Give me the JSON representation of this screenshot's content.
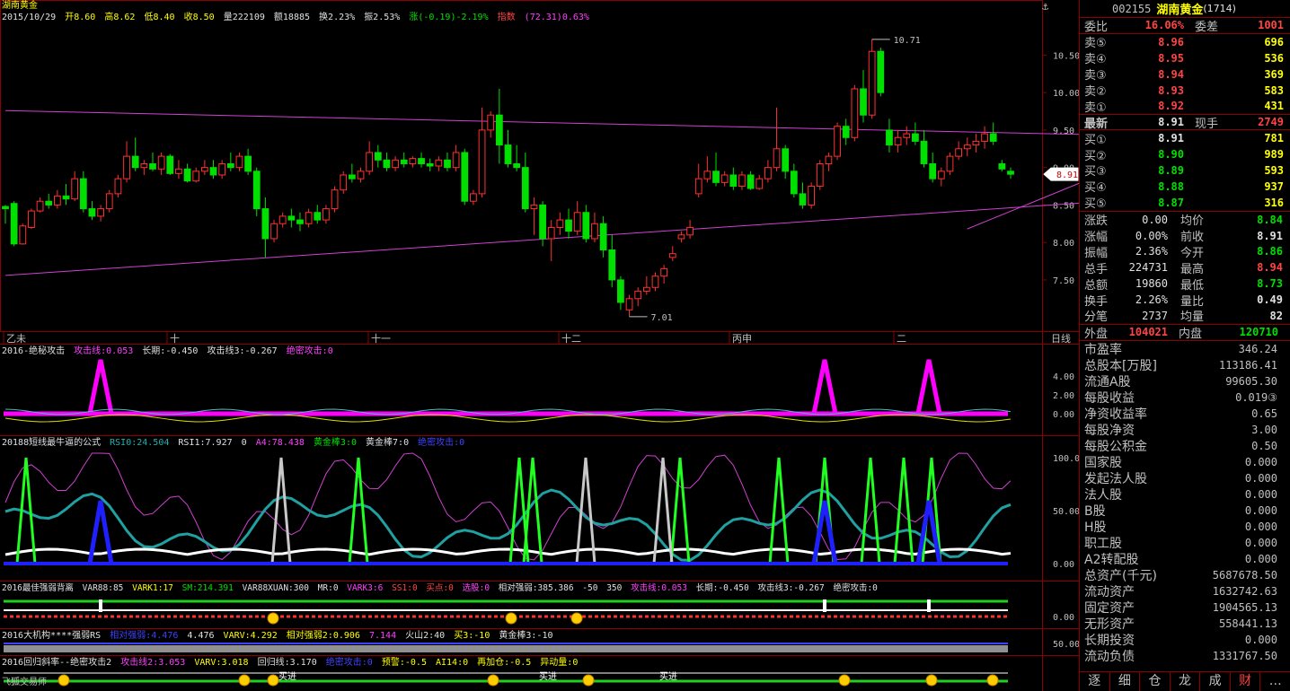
{
  "stock": {
    "name_cn": "湖南黄金",
    "date": "2015/10/29",
    "open": "开8.60",
    "high": "高8.62",
    "low": "低8.40",
    "close": "收8.50",
    "volume": "量222109",
    "amount": "额18885",
    "turnover": "换2.23%",
    "amplitude": "振2.53%",
    "change": "涨(-0.19)-2.19%",
    "index_label": "指数",
    "index_value": "(72.31)0.63%"
  },
  "price_axis": {
    "ticks": [
      "10.50",
      "10.00",
      "9.50",
      "9.00",
      "8.50",
      "8.00",
      "7.50"
    ],
    "current_price": "8.91",
    "high_mark": "10.71",
    "low_mark": "7.01"
  },
  "time_axis": {
    "labels": [
      "乙未",
      "十",
      "十一",
      "十二",
      "丙申",
      "二"
    ],
    "period": "日线"
  },
  "indicators": {
    "ind1": {
      "title": "2016-绝秘攻击",
      "params": [
        "攻击线:0.053",
        "长期:-0.450",
        "攻击线3:-0.267",
        "绝密攻击:0"
      ],
      "ticks": [
        "4.00",
        "2.00",
        "0.00"
      ]
    },
    "ind2": {
      "title": "20188短线最牛逼的公式",
      "params": [
        "RSI0:24.504",
        "RSI1:7.927",
        "0",
        "A4:78.438",
        "黄金棒3:0",
        "黄金棒7:0",
        "绝密攻击:0"
      ],
      "ticks": [
        "100.00",
        "50.00",
        "0.00"
      ]
    },
    "ind3": {
      "title": "2016最佳强弱背离",
      "params": [
        "VAR88:85",
        "VARK1:17",
        "SM:214.391",
        "VAR88XUAN:300",
        "MR:0",
        "VARK3:6",
        "SS1:0",
        "买点:0",
        "选股:0",
        "相对强弱:385.386",
        "-50",
        "350",
        "攻击线:0.053",
        "长期:-0.450",
        "攻击线3:-0.267",
        "绝密攻击:0"
      ],
      "ticks": [
        "0.00"
      ]
    },
    "ind4": {
      "title": "2016大机构****强弱RS",
      "params": [
        "相对强弱:4.476",
        "4.476",
        "VARV:4.292",
        "相对强弱2:0.906",
        "7.144",
        "火山2:40",
        "买3:-10",
        "黄金棒3:-10"
      ],
      "ticks": [
        "50.00"
      ]
    },
    "ind5": {
      "title": "2016回归斜率--绝密攻击2",
      "params": [
        "攻击线2:3.053",
        "VARV:3.018",
        "回归线:3.170",
        "绝密攻击:0",
        "预警:-0.5",
        "AI14:0",
        "再加仓:-0.5",
        "异动量:0"
      ],
      "footer": "飞狐交易师",
      "marker_text": "买进"
    }
  },
  "quote": {
    "code": "002155",
    "name": "湖南黄金",
    "code_suffix": "(1714)",
    "wei_bi_label": "委比",
    "wei_bi": "16.06%",
    "wei_cha_label": "委差",
    "wei_cha": "1001",
    "sell": [
      {
        "label": "卖⑤",
        "price": "8.96",
        "vol": "696"
      },
      {
        "label": "卖④",
        "price": "8.95",
        "vol": "536"
      },
      {
        "label": "卖③",
        "price": "8.94",
        "vol": "369"
      },
      {
        "label": "卖②",
        "price": "8.93",
        "vol": "583"
      },
      {
        "label": "卖①",
        "price": "8.92",
        "vol": "431"
      }
    ],
    "latest_label": "最新",
    "latest": "8.91",
    "xianshou_label": "现手",
    "xianshou": "2749",
    "buy": [
      {
        "label": "买①",
        "price": "8.91",
        "vol": "781"
      },
      {
        "label": "买②",
        "price": "8.90",
        "vol": "989"
      },
      {
        "label": "买③",
        "price": "8.89",
        "vol": "593"
      },
      {
        "label": "买④",
        "price": "8.88",
        "vol": "937"
      },
      {
        "label": "买⑤",
        "price": "8.87",
        "vol": "316"
      }
    ],
    "stats": [
      {
        "l1": "涨跌",
        "v1": "0.00",
        "l2": "均价",
        "v2": "8.84",
        "c2": "green"
      },
      {
        "l1": "涨幅",
        "v1": "0.00%",
        "l2": "前收",
        "v2": "8.91",
        "c2": "white"
      },
      {
        "l1": "振幅",
        "v1": "2.36%",
        "l2": "今开",
        "v2": "8.86",
        "c2": "green"
      },
      {
        "l1": "总手",
        "v1": "224731",
        "l2": "最高",
        "v2": "8.94",
        "c2": "red"
      },
      {
        "l1": "总额",
        "v1": "19860",
        "l2": "最低",
        "v2": "8.73",
        "c2": "green"
      },
      {
        "l1": "换手",
        "v1": "2.26%",
        "l2": "量比",
        "v2": "0.49",
        "c2": "white"
      },
      {
        "l1": "分笔",
        "v1": "2737",
        "l2": "均量",
        "v2": "82",
        "c2": "white"
      }
    ],
    "waipan_label": "外盘",
    "waipan": "104021",
    "neipan_label": "内盘",
    "neipan": "120710",
    "fundamentals": [
      {
        "label": "市盈率",
        "value": "346.24"
      },
      {
        "label": "总股本[万股]",
        "value": "113186.41"
      },
      {
        "label": "流通A股",
        "value": "99605.30"
      },
      {
        "label": "每股收益",
        "value": "0.019③"
      },
      {
        "label": "净资收益率",
        "value": "0.65"
      },
      {
        "label": "每股净资",
        "value": "3.00"
      },
      {
        "label": "每股公积金",
        "value": "0.50"
      },
      {
        "label": "国家股",
        "value": "0.000"
      },
      {
        "label": "发起法人股",
        "value": "0.000"
      },
      {
        "label": "法人股",
        "value": "0.000"
      },
      {
        "label": "B股",
        "value": "0.000"
      },
      {
        "label": "H股",
        "value": "0.000"
      },
      {
        "label": "职工股",
        "value": "0.000"
      },
      {
        "label": "A2转配股",
        "value": "0.000"
      },
      {
        "label": "总资产(千元)",
        "value": "5687678.50"
      },
      {
        "label": "流动资产",
        "value": "1632742.63"
      },
      {
        "label": "固定资产",
        "value": "1904565.13"
      },
      {
        "label": "无形资产",
        "value": "558441.13"
      },
      {
        "label": "长期投资",
        "value": "0.000"
      },
      {
        "label": "流动负债",
        "value": "1331767.50"
      }
    ],
    "tabs": [
      "逐",
      "细",
      "仓",
      "龙",
      "成",
      "财",
      "…"
    ]
  },
  "chart_data": {
    "type": "candlestick",
    "title": "湖南黄金",
    "ylim": [
      6.9,
      10.9
    ],
    "up_color": "#ff3030",
    "down_color": "#00e000",
    "candles": [
      [
        8.48,
        8.5,
        8.25,
        8.45
      ],
      [
        8.52,
        8.55,
        7.95,
        7.98
      ],
      [
        7.98,
        8.25,
        7.97,
        8.22
      ],
      [
        8.2,
        8.45,
        8.18,
        8.42
      ],
      [
        8.42,
        8.6,
        8.4,
        8.55
      ],
      [
        8.55,
        8.65,
        8.45,
        8.5
      ],
      [
        8.5,
        8.7,
        8.45,
        8.62
      ],
      [
        8.62,
        8.78,
        8.5,
        8.58
      ],
      [
        8.58,
        8.95,
        8.55,
        8.85
      ],
      [
        8.85,
        8.95,
        8.4,
        8.45
      ],
      [
        8.45,
        8.55,
        8.3,
        8.35
      ],
      [
        8.35,
        8.5,
        8.28,
        8.45
      ],
      [
        8.45,
        8.7,
        8.4,
        8.65
      ],
      [
        8.65,
        8.9,
        8.6,
        8.85
      ],
      [
        8.85,
        9.35,
        8.8,
        9.15
      ],
      [
        9.15,
        9.4,
        8.95,
        9.0
      ],
      [
        9.0,
        9.1,
        8.9,
        9.05
      ],
      [
        9.05,
        9.2,
        8.95,
        8.98
      ],
      [
        8.98,
        9.2,
        8.9,
        9.15
      ],
      [
        9.15,
        9.18,
        8.9,
        8.92
      ],
      [
        8.92,
        9.1,
        8.85,
        8.98
      ],
      [
        8.98,
        9.05,
        8.8,
        8.82
      ],
      [
        8.82,
        9.0,
        8.8,
        8.95
      ],
      [
        8.95,
        9.1,
        8.9,
        9.0
      ],
      [
        9.0,
        9.1,
        8.85,
        8.9
      ],
      [
        8.9,
        9.1,
        8.85,
        9.05
      ],
      [
        9.05,
        9.2,
        8.95,
        9.0
      ],
      [
        9.0,
        9.2,
        8.95,
        9.15
      ],
      [
        9.15,
        9.25,
        8.9,
        8.95
      ],
      [
        8.95,
        9.0,
        8.35,
        8.45
      ],
      [
        8.45,
        8.6,
        7.8,
        8.05
      ],
      [
        8.05,
        8.3,
        8.0,
        8.25
      ],
      [
        8.25,
        8.4,
        8.2,
        8.35
      ],
      [
        8.35,
        8.45,
        8.2,
        8.3
      ],
      [
        8.3,
        8.4,
        8.15,
        8.25
      ],
      [
        8.25,
        8.45,
        8.2,
        8.4
      ],
      [
        8.4,
        8.5,
        8.25,
        8.3
      ],
      [
        8.3,
        8.5,
        8.25,
        8.45
      ],
      [
        8.45,
        8.75,
        8.4,
        8.7
      ],
      [
        8.7,
        8.95,
        8.65,
        8.9
      ],
      [
        8.9,
        9.05,
        8.8,
        8.85
      ],
      [
        8.85,
        9.0,
        8.8,
        8.95
      ],
      [
        8.95,
        9.35,
        8.9,
        9.2
      ],
      [
        9.2,
        9.3,
        9.0,
        9.1
      ],
      [
        9.1,
        9.2,
        8.95,
        9.0
      ],
      [
        9.0,
        9.15,
        8.95,
        9.1
      ],
      [
        9.1,
        9.2,
        9.0,
        9.05
      ],
      [
        9.05,
        9.15,
        9.0,
        9.12
      ],
      [
        9.12,
        9.2,
        9.0,
        9.05
      ],
      [
        9.05,
        9.12,
        8.95,
        9.02
      ],
      [
        9.02,
        9.15,
        8.95,
        9.1
      ],
      [
        9.1,
        9.2,
        8.95,
        9.0
      ],
      [
        9.0,
        9.3,
        8.95,
        9.2
      ],
      [
        9.2,
        9.25,
        8.5,
        8.55
      ],
      [
        8.55,
        8.7,
        8.5,
        8.65
      ],
      [
        8.65,
        9.8,
        8.6,
        9.5
      ],
      [
        9.5,
        9.75,
        9.4,
        9.7
      ],
      [
        9.7,
        10.05,
        9.05,
        9.3
      ],
      [
        9.3,
        9.5,
        9.0,
        9.05
      ],
      [
        9.05,
        9.3,
        8.95,
        9.0
      ],
      [
        9.0,
        9.2,
        8.4,
        8.45
      ],
      [
        8.45,
        8.6,
        8.1,
        8.5
      ],
      [
        8.5,
        8.55,
        7.95,
        8.05
      ],
      [
        8.05,
        8.3,
        7.75,
        8.2
      ],
      [
        8.2,
        8.4,
        8.1,
        8.3
      ],
      [
        8.3,
        8.45,
        8.05,
        8.15
      ],
      [
        8.15,
        8.55,
        8.1,
        8.4
      ],
      [
        8.4,
        8.5,
        8.0,
        8.05
      ],
      [
        8.05,
        8.4,
        8.0,
        8.25
      ],
      [
        8.25,
        8.35,
        7.8,
        7.9
      ],
      [
        7.9,
        8.1,
        7.4,
        7.5
      ],
      [
        7.5,
        7.55,
        7.1,
        7.2
      ],
      [
        7.1,
        7.3,
        7.01,
        7.25
      ],
      [
        7.25,
        7.4,
        7.15,
        7.35
      ],
      [
        7.35,
        7.55,
        7.3,
        7.4
      ],
      [
        7.4,
        7.6,
        7.35,
        7.55
      ],
      [
        7.55,
        7.7,
        7.45,
        7.65
      ],
      [
        7.8,
        7.95,
        7.75,
        7.85
      ],
      [
        8.05,
        8.15,
        8.0,
        8.1
      ],
      [
        8.1,
        8.3,
        8.05,
        8.2
      ],
      [
        8.65,
        9.05,
        8.6,
        8.85
      ],
      [
        8.85,
        9.15,
        8.8,
        8.95
      ],
      [
        8.95,
        9.2,
        8.75,
        8.8
      ],
      [
        8.8,
        8.95,
        8.75,
        8.9
      ],
      [
        8.9,
        9.0,
        8.7,
        8.75
      ],
      [
        8.75,
        8.95,
        8.7,
        8.9
      ],
      [
        8.9,
        8.95,
        8.7,
        8.72
      ],
      [
        8.72,
        8.9,
        8.7,
        8.85
      ],
      [
        8.85,
        9.1,
        8.8,
        9.0
      ],
      [
        9.0,
        9.8,
        8.95,
        9.25
      ],
      [
        9.25,
        9.3,
        8.85,
        8.95
      ],
      [
        8.95,
        9.05,
        8.6,
        8.65
      ],
      [
        8.65,
        8.8,
        8.45,
        8.5
      ],
      [
        8.5,
        8.8,
        8.45,
        8.75
      ],
      [
        8.75,
        9.1,
        8.7,
        9.05
      ],
      [
        9.05,
        9.2,
        8.95,
        9.15
      ],
      [
        9.15,
        9.6,
        9.1,
        9.55
      ],
      [
        9.55,
        9.65,
        9.3,
        9.4
      ],
      [
        9.4,
        10.1,
        9.35,
        10.05
      ],
      [
        10.05,
        10.3,
        9.6,
        9.7
      ],
      [
        9.7,
        10.71,
        9.65,
        10.55
      ],
      [
        10.55,
        10.6,
        9.95,
        10.0
      ],
      [
        9.5,
        9.65,
        9.2,
        9.3
      ],
      [
        9.3,
        9.5,
        9.2,
        9.4
      ],
      [
        9.4,
        9.55,
        9.3,
        9.45
      ],
      [
        9.45,
        9.6,
        9.3,
        9.35
      ],
      [
        9.35,
        9.5,
        9.0,
        9.05
      ],
      [
        9.05,
        9.2,
        8.8,
        8.85
      ],
      [
        8.85,
        9.0,
        8.75,
        8.95
      ],
      [
        8.95,
        9.2,
        8.9,
        9.15
      ],
      [
        9.15,
        9.35,
        9.1,
        9.25
      ],
      [
        9.25,
        9.4,
        9.15,
        9.3
      ],
      [
        9.3,
        9.45,
        9.2,
        9.35
      ],
      [
        9.35,
        9.55,
        9.25,
        9.45
      ],
      [
        9.45,
        9.6,
        9.3,
        9.35
      ],
      [
        9.05,
        9.1,
        8.95,
        8.98
      ],
      [
        8.95,
        9.0,
        8.85,
        8.91
      ]
    ],
    "trendlines": [
      {
        "from": [
          0,
          9.76
        ],
        "to": [
          140,
          9.4
        ]
      },
      {
        "from": [
          0,
          7.56
        ],
        "to": [
          140,
          8.65
        ]
      },
      {
        "from": [
          111,
          8.18
        ],
        "to": [
          140,
          9.55
        ]
      }
    ]
  }
}
